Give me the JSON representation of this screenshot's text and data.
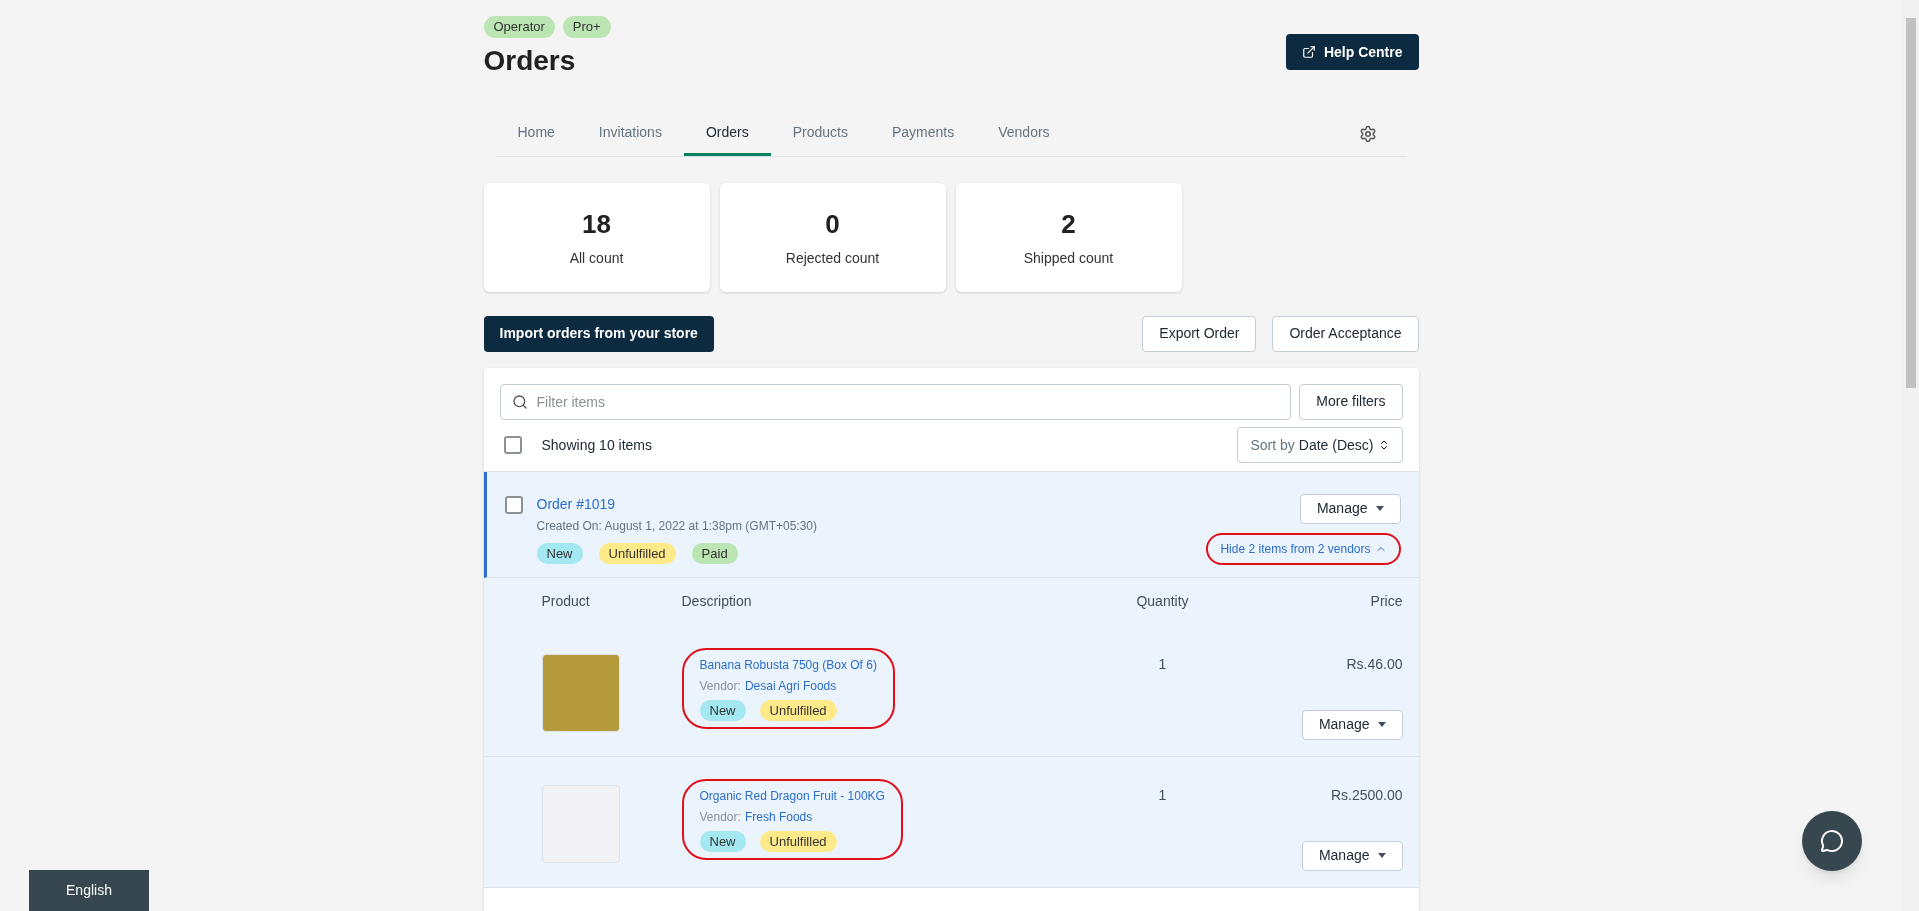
{
  "roles": [
    "Operator",
    "Pro+"
  ],
  "title": "Orders",
  "help_button": "Help Centre",
  "tabs": [
    {
      "label": "Home",
      "selected": false
    },
    {
      "label": "Invitations",
      "selected": false
    },
    {
      "label": "Orders",
      "selected": true
    },
    {
      "label": "Products",
      "selected": false
    },
    {
      "label": "Payments",
      "selected": false
    },
    {
      "label": "Vendors",
      "selected": false
    }
  ],
  "stats": [
    {
      "value": "18",
      "label": "All count"
    },
    {
      "value": "0",
      "label": "Rejected count"
    },
    {
      "value": "2",
      "label": "Shipped count"
    }
  ],
  "import_button": "Import orders from your store",
  "actions": [
    "Export Order",
    "Order Acceptance"
  ],
  "filter": {
    "placeholder": "Filter items",
    "more_filters": "More filters"
  },
  "showing": {
    "text": "Showing 10 items",
    "checked": false
  },
  "sort": {
    "label": "Sort by",
    "value": "Date (Desc)"
  },
  "order": {
    "number": "Order #1019",
    "checked": false,
    "created": "Created On: August 1, 2022 at 1:38pm (GMT+05:30)",
    "tags": [
      {
        "label": "New",
        "color": "#a4e8f2"
      },
      {
        "label": "Unfulfilled",
        "color": "#ffea8a"
      },
      {
        "label": "Paid",
        "color": "#bbe5b3"
      }
    ],
    "manage": "Manage",
    "toggle": {
      "label": "Hide 2 items from 2 vendors",
      "expanded": true,
      "highlighted": true
    }
  },
  "columns": [
    "Product",
    "Description",
    "Quantity",
    "Price"
  ],
  "items": [
    {
      "name": "Banana Robusta 750g (Box Of 6)",
      "vendor_label": "Vendor:",
      "vendor": "Desai Agri Foods",
      "tags": [
        {
          "label": "New",
          "color": "#a4e8f2"
        },
        {
          "label": "Unfulfilled",
          "color": "#ffea8a"
        }
      ],
      "quantity": "1",
      "price": "Rs.46.00",
      "manage": "Manage",
      "highlighted": true
    },
    {
      "name": "Organic Red Dragon Fruit - 100KG",
      "vendor_label": "Vendor:",
      "vendor": "Fresh Foods",
      "tags": [
        {
          "label": "New",
          "color": "#a4e8f2"
        },
        {
          "label": "Unfulfilled",
          "color": "#ffea8a"
        }
      ],
      "quantity": "1",
      "price": "Rs.2500.00",
      "manage": "Manage",
      "highlighted": true
    }
  ],
  "language": "English"
}
